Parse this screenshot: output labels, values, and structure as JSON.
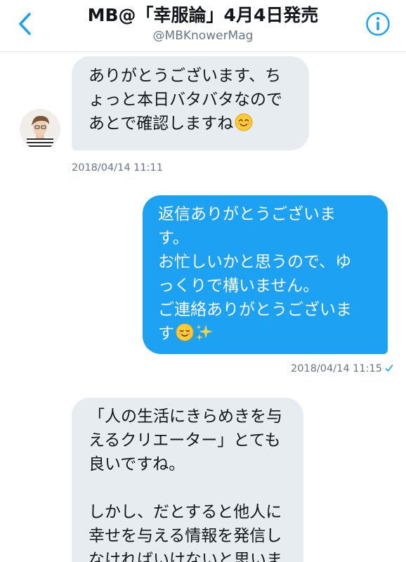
{
  "header": {
    "title": "MB@「幸服論」4月4日発売",
    "handle": "@MBKnowerMag"
  },
  "colors": {
    "accent": "#1da1f2",
    "received_bubble": "#e6ecf0",
    "meta_text": "#657786"
  },
  "icons": {
    "back": "chevron-left",
    "info": "info-circle",
    "read_receipt": "checkmark"
  },
  "messages": [
    {
      "direction": "received",
      "text": "ありがとうございます、ち\nょっと本日バタバタなので\nあとで確認しますね",
      "emoji": [
        "smiling-face-with-smiling-eyes"
      ],
      "timestamp": "2018/04/14 11:11"
    },
    {
      "direction": "sent",
      "text": "返信ありがとうございま\nす。\nお忙しいかと思うので、ゆ\nっくりで構いません。\nご連絡ありがとうございま\nす",
      "emoji": [
        "smiling-face",
        "sparkles"
      ],
      "timestamp": "2018/04/14 11:15"
    },
    {
      "direction": "received",
      "text": "「人の生活にきらめきを与\nえるクリエーター」とても\n良いですね。\n\nしかし、だとすると他人に\n幸せを与える情報を発信し\nなければいけないと思いま"
    }
  ]
}
